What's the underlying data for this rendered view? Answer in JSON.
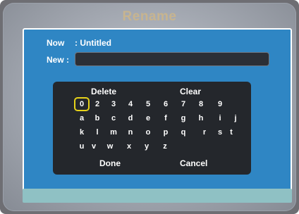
{
  "dialog": {
    "title": "Rename",
    "now_label": "Now",
    "now_value": ": Untitled",
    "new_label": "New :",
    "new_value": ""
  },
  "keyboard": {
    "delete_label": "Delete",
    "clear_label": "Clear",
    "done_label": "Done",
    "cancel_label": "Cancel",
    "selected_key": "0",
    "rows": [
      [
        "0",
        "2",
        "3",
        "4",
        "5",
        "6",
        "7",
        "8",
        "9"
      ],
      [
        "a",
        "b",
        "c",
        "d",
        "e",
        "f",
        "g",
        "h",
        "i",
        "j"
      ],
      [
        "k",
        "l",
        "m",
        "n",
        "o",
        "p",
        "q",
        "r",
        "s",
        "t"
      ],
      [
        "u",
        "v",
        "w",
        "x",
        "y",
        "z"
      ]
    ]
  },
  "colors": {
    "panel": "#2f86c4",
    "title": "#c7b48f",
    "selection": "#e6d21a"
  }
}
